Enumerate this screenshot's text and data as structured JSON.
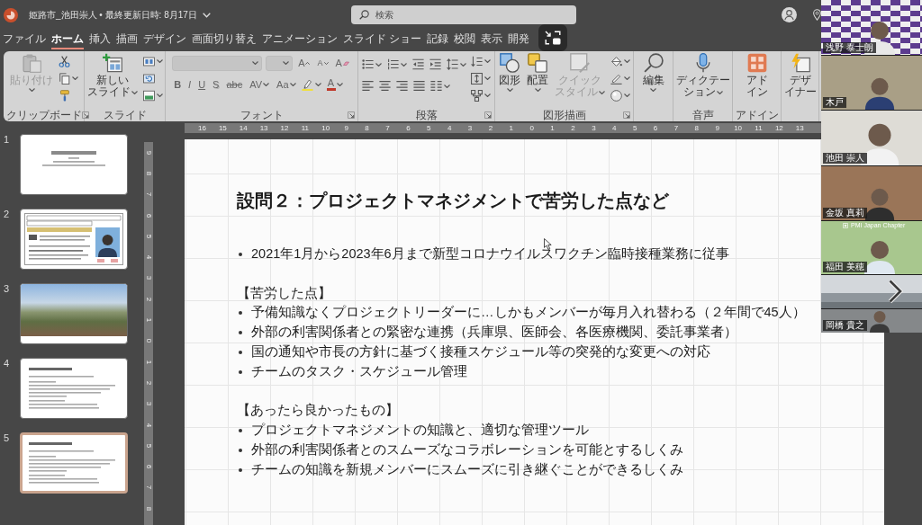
{
  "title_bar": {
    "document": "姫路市_池田崇人 • 最終更新日時: 8月17日",
    "search": {
      "placeholder": "検索"
    }
  },
  "tabs": [
    {
      "label": "ファイル",
      "selected": false
    },
    {
      "label": "ホーム",
      "selected": true
    },
    {
      "label": "挿入",
      "selected": false
    },
    {
      "label": "描画",
      "selected": false
    },
    {
      "label": "デザイン",
      "selected": false
    },
    {
      "label": "画面切り替え",
      "selected": false
    },
    {
      "label": "アニメーション",
      "selected": false
    },
    {
      "label": "スライド ショー",
      "selected": false
    },
    {
      "label": "記録",
      "selected": false
    },
    {
      "label": "校閲",
      "selected": false
    },
    {
      "label": "表示",
      "selected": false
    },
    {
      "label": "開発",
      "selected": false
    }
  ],
  "ribbon": {
    "clipboard": {
      "label": "クリップボード",
      "paste": {
        "label": "貼り付け",
        "disabled": true
      }
    },
    "slides": {
      "label": "スライド",
      "new_slide": {
        "lines": [
          "新しい",
          "スライド"
        ]
      }
    },
    "font": {
      "label": "フォント",
      "font_name": {
        "disabled": true
      },
      "font_size": {
        "disabled": true
      },
      "size_buttons": [
        "A",
        "A",
        "A"
      ],
      "format_buttons": [
        "B",
        "I",
        "U",
        "S",
        "abc",
        "AV",
        "Aa"
      ],
      "font_color": {
        "label": "A"
      }
    },
    "paragraph": {
      "label": "段落"
    },
    "drawing": {
      "label": "図形描画",
      "buttons": [
        {
          "lines": [
            "図形"
          ],
          "disabled": false
        },
        {
          "lines": [
            "配置"
          ],
          "disabled": false
        },
        {
          "lines": [
            "クイック",
            "スタイル"
          ],
          "disabled": true
        }
      ]
    },
    "editing": {
      "button": "編集"
    },
    "voice": {
      "label": "音声",
      "button_lines": [
        "ディクテー",
        "ション"
      ]
    },
    "addins": {
      "label": "アドイン",
      "button_lines": [
        "アド",
        "イン"
      ]
    },
    "designer": {
      "button_lines": [
        "デザ",
        "イナー"
      ]
    }
  },
  "slides": [
    {
      "number": "1",
      "kind": "title",
      "selected": false
    },
    {
      "number": "2",
      "kind": "profile",
      "selected": false
    },
    {
      "number": "3",
      "kind": "photo",
      "selected": false
    },
    {
      "number": "4",
      "kind": "text",
      "selected": false
    },
    {
      "number": "5",
      "kind": "text",
      "selected": true
    }
  ],
  "rulers": {
    "horizontal": [
      "16",
      "15",
      "14",
      "13",
      "12",
      "11",
      "10",
      "9",
      "8",
      "7",
      "6",
      "5",
      "4",
      "3",
      "2",
      "1",
      "0",
      "1",
      "2",
      "3",
      "4",
      "5",
      "6",
      "7",
      "8",
      "9",
      "10",
      "11",
      "12",
      "13"
    ],
    "vertical": [
      "9",
      "8",
      "7",
      "6",
      "5",
      "4",
      "3",
      "2",
      "1",
      "0",
      "1",
      "2",
      "3",
      "4",
      "5",
      "6",
      "7",
      "8"
    ]
  },
  "slide": {
    "title": "設問２：プロジェクトマネジメントで苦労した点など",
    "sections": [
      {
        "bullets": [
          "2021年1月から2023年6月まで新型コロナウイルスワクチン臨時接種業務に従事"
        ]
      },
      {
        "heading": "【苦労した点】",
        "bullets": [
          "予備知識なくプロジェクトリーダーに…しかもメンバーが毎月入れ替わる（２年間で45人）",
          "外部の利害関係者との緊密な連携（兵庫県、医師会、各医療機関、委託事業者）",
          "国の通知や市長の方針に基づく接種スケジュール等の突発的な変更への対応",
          "チームのタスク・スケジュール管理"
        ]
      },
      {
        "heading": "【あったら良かったもの】",
        "bullets": [
          "プロジェクトマネジメントの知識と、適切な管理ツール",
          "外部の利害関係者とのスムーズなコラボレーションを可能とするしくみ",
          "チームの知識を新規メンバーにスムーズに引き継ぐことができるしくみ"
        ]
      }
    ]
  },
  "video_call": {
    "participants": [
      {
        "kind": "person",
        "name": "浅野 泰士朗"
      },
      {
        "kind": "person",
        "name": "木戸"
      },
      {
        "kind": "person",
        "name": "池田 崇人"
      },
      {
        "kind": "person",
        "name": "金坂 真莉"
      },
      {
        "kind": "person",
        "name": "福田 美穂",
        "caption": "PMI Japan Chapter"
      },
      {
        "kind": "scenery"
      },
      {
        "kind": "person",
        "name": "岡橋 貴之"
      }
    ]
  }
}
